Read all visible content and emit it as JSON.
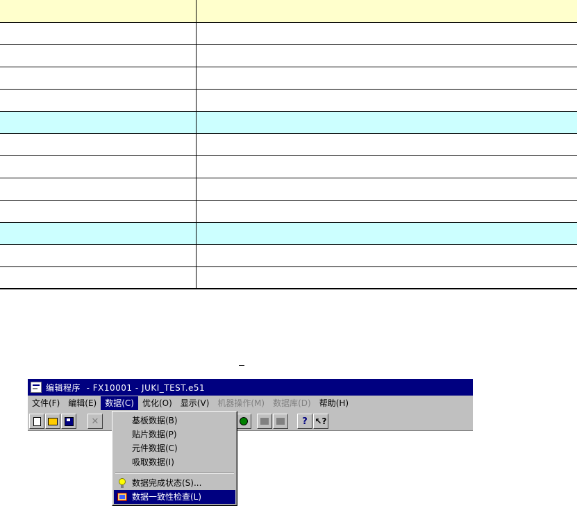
{
  "table": {
    "rows": [
      {
        "kind": "header",
        "cells": [
          "",
          ""
        ]
      },
      {
        "kind": "normal",
        "cells": [
          "",
          ""
        ]
      },
      {
        "kind": "normal",
        "cells": [
          "",
          ""
        ]
      },
      {
        "kind": "normal",
        "cells": [
          "",
          ""
        ]
      },
      {
        "kind": "normal",
        "cells": [
          "",
          ""
        ]
      },
      {
        "kind": "section",
        "cells": [
          "",
          ""
        ]
      },
      {
        "kind": "normal",
        "cells": [
          "",
          ""
        ]
      },
      {
        "kind": "normal",
        "cells": [
          "",
          ""
        ]
      },
      {
        "kind": "normal",
        "cells": [
          "",
          ""
        ]
      },
      {
        "kind": "normal",
        "cells": [
          "",
          ""
        ]
      },
      {
        "kind": "section",
        "cells": [
          "",
          ""
        ]
      },
      {
        "kind": "normal",
        "cells": [
          "",
          ""
        ]
      },
      {
        "kind": "normal",
        "cells": [
          "",
          ""
        ]
      }
    ],
    "colors": {
      "header": "#ffffcc",
      "section": "#ccffff"
    }
  },
  "app": {
    "title": "编辑程序  - FX10001 - JUKI_TEST.e51",
    "menu": [
      {
        "label": "文件(F)",
        "state": "normal"
      },
      {
        "label": "编辑(E)",
        "state": "normal"
      },
      {
        "label": "数据(C)",
        "state": "active"
      },
      {
        "label": "优化(O)",
        "state": "normal"
      },
      {
        "label": "显示(V)",
        "state": "normal"
      },
      {
        "label": "机器操作(M)",
        "state": "disabled"
      },
      {
        "label": "数据库(D)",
        "state": "disabled"
      },
      {
        "label": "帮助(H)",
        "state": "normal"
      }
    ],
    "toolbar": {
      "new_icon": "new-file-icon",
      "open_icon": "open-folder-icon",
      "save_icon": "save-disk-icon",
      "delete_glyph": "✕",
      "help_glyph": "?",
      "whats_this_glyph": "↖?"
    },
    "dropdown": {
      "items": [
        {
          "label": "基板数据(B)"
        },
        {
          "label": "贴片数据(P)"
        },
        {
          "label": "元件数据(C)"
        },
        {
          "label": "吸取数据(I)"
        },
        {
          "label": "数据完成状态(S)...",
          "icon": "lightbulb-icon"
        },
        {
          "label": "数据一致性检查(L)",
          "icon": "consistency-check-icon",
          "selected": true
        }
      ]
    }
  },
  "colors": {
    "title_bar": "#000080",
    "window_face": "#c0c0c0",
    "highlight": "#000080"
  }
}
